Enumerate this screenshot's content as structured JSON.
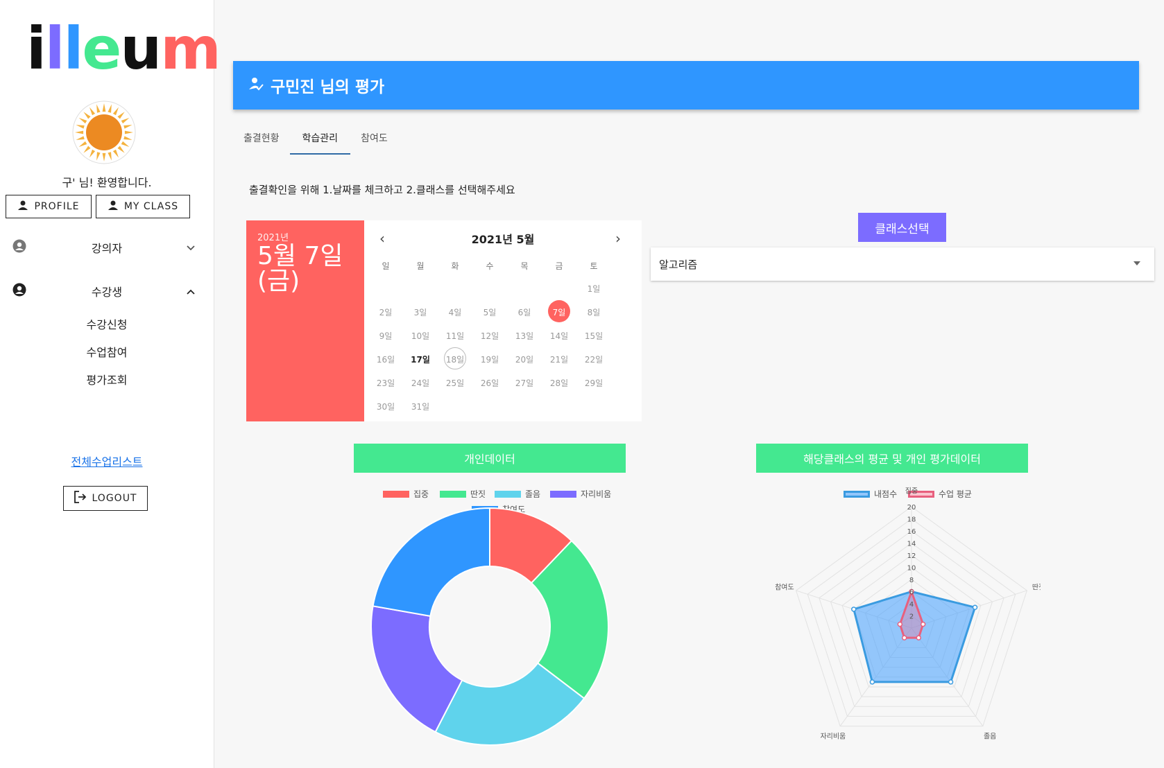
{
  "brand": {
    "logo_letters": [
      "i",
      "l",
      "l",
      "e",
      "u",
      "m"
    ],
    "logo_colors": [
      "#111111",
      "#7c6cff",
      "#2f96ff",
      "#44e890",
      "#111111",
      "#ff6360"
    ]
  },
  "user": {
    "welcome": "구' 님! 환영합니다."
  },
  "sidebar": {
    "profile_label": "PROFILE",
    "myclass_label": "MY CLASS",
    "teacher_label": "강의자",
    "student_label": "수강생",
    "student_items": [
      "수강신청",
      "수업참여",
      "평가조회"
    ],
    "all_classes_link": "전체수업리스트",
    "logout_label": "LOGOUT"
  },
  "header": {
    "title": "구민진 님의 평가"
  },
  "tabs": [
    "출결현황",
    "학습관리",
    "참여도"
  ],
  "active_tab": "학습관리",
  "instruction": "출결확인을 위해 1.날짜를 체크하고 2.클래스를 선택해주세요",
  "calendar": {
    "selected_year": "2021년",
    "selected_date": "5월 7일",
    "selected_weekday": "(금)",
    "month_label": "2021년 5월",
    "weekdays": [
      "일",
      "월",
      "화",
      "수",
      "목",
      "금",
      "토"
    ],
    "first_weekday_index": 6,
    "days_in_month": 31,
    "selected_day": 7,
    "today_day": 17,
    "ring_day": 18,
    "prev_icon": "‹",
    "next_icon": "›"
  },
  "class_select": {
    "button_label": "클래스선택",
    "value": "알고리즘"
  },
  "donut": {
    "title": "개인데이터",
    "chart_data": {
      "type": "pie",
      "categories": [
        "집중",
        "딴짓",
        "졸음",
        "자리비움",
        "참여도"
      ],
      "values": [
        12,
        23,
        22,
        20,
        22
      ],
      "colors": [
        "#ff6360",
        "#44e890",
        "#5fd3ec",
        "#7c6cff",
        "#2f96ff"
      ],
      "legend": "top"
    }
  },
  "radar": {
    "title": "해당클래스의 평균 및 개인 평가데이터",
    "chart_data": {
      "type": "radar",
      "categories": [
        "집중",
        "딴짓",
        "졸음",
        "자리비움",
        "참여도"
      ],
      "ticks": [
        2,
        4,
        6,
        8,
        10,
        12,
        14,
        16,
        18,
        20
      ],
      "ylim": [
        0,
        20
      ],
      "series": [
        {
          "name": "내점수",
          "values": [
            6,
            11,
            11,
            11,
            10
          ],
          "color": "#2f96ff"
        },
        {
          "name": "수업 평균",
          "values": [
            6,
            2,
            2,
            2,
            2
          ],
          "color": "#ff6384"
        }
      ],
      "legend": "top"
    }
  }
}
